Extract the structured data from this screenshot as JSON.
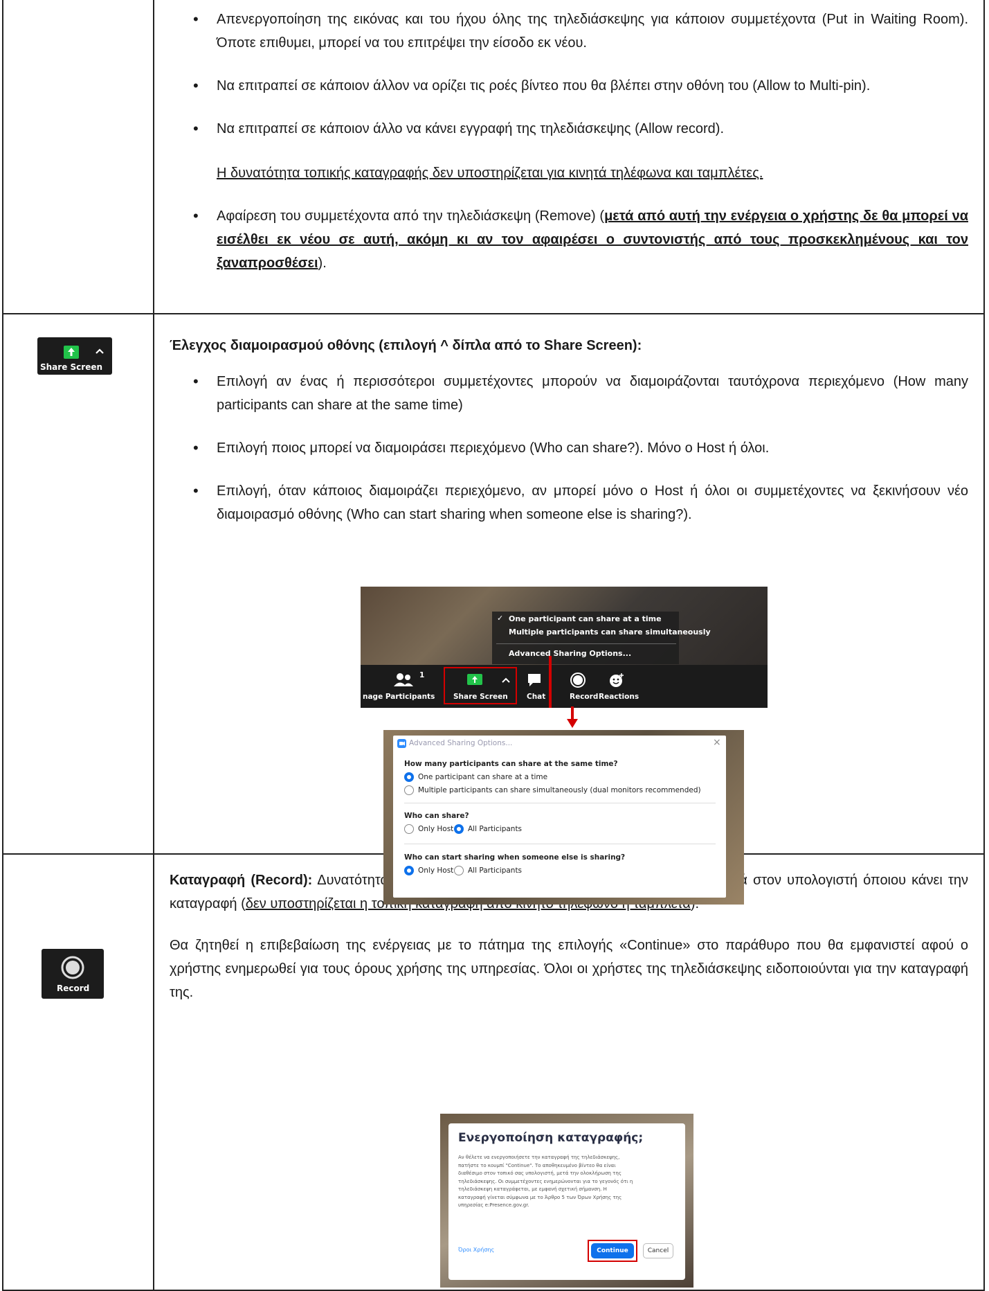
{
  "row1": {
    "bullets": [
      "Απενεργοποίηση της εικόνας και του ήχου όλης της τηλεδιάσκεψης για κάποιον συμμετέχοντα (Put in Waiting Room). Όποτε επιθυμει, μπορεί να του επιτρέψει την είσοδο εκ νέου.",
      "Να επιτραπεί σε κάποιον άλλον να ορίζει τις ροές βίντεο που θα βλέπει στην οθόνη του (Allow to Multi-pin).",
      "Να επιτραπεί σε κάποιον άλλο να κάνει εγγραφή της τηλεδιάσκεψης (Allow record)."
    ],
    "note": "Η δυνατότητα τοπικής καταγραφής δεν υποστηρίζεται για κινητά τηλέφωνα και ταμπλέτες.",
    "remove_prefix": "Αφαίρεση του συμμετέχοντα από την τηλεδιάσκεψη (Remove) (",
    "remove_warning": "μετά από αυτή την ενέργεια ο χρήστης δε θα μπορεί να εισέλθει εκ νέου σε αυτή, ακόμη κι αν τον αφαιρέσει ο συντονιστής από τους προσκεκλημένους και τον ξαναπροσθέσει",
    "remove_suffix": ")."
  },
  "row2": {
    "icon_label": "Share Screen",
    "heading": "Έλεγχος διαμοιρασμού οθόνης (επιλογή ^ δίπλα από το Share Screen):",
    "bullets": [
      "Επιλογή αν ένας ή περισσότεροι συμμετέχοντες μπορούν να διαμοιράζονται ταυτόχρονα περιεχόμενο (How many participants can share at the same time)",
      "Επιλογή ποιος μπορεί να διαμοιράσει περιεχόμενο (Who can share?). Μόνο ο Host ή όλοι.",
      "Επιλογή, όταν κάποιος διαμοιράζει περιεχόμενο, αν μπορεί μόνο ο Host ή όλοι οι συμμετέχοντες να ξεκινήσουν νέο διαμοιρασμό οθόνης (Who can start sharing when someone else is sharing?)."
    ],
    "toolbar_shot": {
      "menu": [
        "One participant can share at a time",
        "Multiple participants can share simultaneously",
        "Advanced Sharing Options..."
      ],
      "checkmark": "✓",
      "participants_count": "1",
      "buttons": [
        "nage Participants",
        "Share Screen",
        "Chat",
        "Record",
        "Reactions"
      ]
    },
    "dialog_shot": {
      "title": "Advanced Sharing Options...",
      "q1": "How many participants can share at the same time?",
      "q1_opt1": "One participant can share at a time",
      "q1_opt2": "Multiple participants can share simultaneously (dual monitors recommended)",
      "q2": "Who can share?",
      "q2_opt1": "Only Host",
      "q2_opt2": "All Participants",
      "q3": "Who can start sharing when someone else is sharing?",
      "q3_opt1": "Only Host",
      "q3_opt2": "All Participants"
    }
  },
  "row3": {
    "icon_label": "Record",
    "para1_bold": "Καταγραφή (Record):",
    "para1_text": " Δυνατότητα καταγραφής της τηλεδιάσκεψης (ήχος και εικόνα) τοπικά στον υπολογιστή όποιου κάνει την καταγραφή (",
    "para1_underlined": "δεν υποστηρίζεται η τοπική καταγραφή από κινητό τηλέφωνο ή ταμπλέτα",
    "para1_end": ").",
    "para2": "Θα ζητηθεί η επιβεβαίωση της ενέργειας με το πάτημα της επιλογής «Continue» στο παράθυρο που θα εμφανιστεί αφού ο χρήστης ενημερωθεί για τους όρους χρήσης της υπηρεσίας. Όλοι οι χρήστες της τηλεδιάσκεψης ειδοποιούνται για την καταγραφή της.",
    "dialog_shot": {
      "title": "Ενεργοποίηση καταγραφής;",
      "body": [
        "Αν θέλετε να ενεργοποιήσετε την καταγραφή της τηλεδιάσκεψης,",
        "πατήστε το κουμπί \"Continue\". Το αποθηκευμένο βίντεο θα είναι",
        "διαθέσιμο στον τοπικό σας υπολογιστή, μετά την ολοκλήρωση της",
        "τηλεδιάσκεψης. Οι συμμετέχοντες ενημερώνονται για το γεγονός ότι η",
        "τηλεδιάσκεψη καταγράφεται, με εμφανή σχετική σήμανση. Η",
        "καταγραφή γίνεται σύμφωνα με το Άρθρο 5 των Όρων Χρήσης της",
        "υπηρεσίας e:Presence.gov.gr."
      ],
      "terms_link": "Όροι Χρήσης",
      "continue": "Continue",
      "cancel": "Cancel"
    }
  },
  "colors": {
    "zoom_dark": "#1c1c1c",
    "zoom_green": "#22c34a",
    "zoom_blue": "#0e71eb",
    "highlight_red": "#d40000"
  }
}
